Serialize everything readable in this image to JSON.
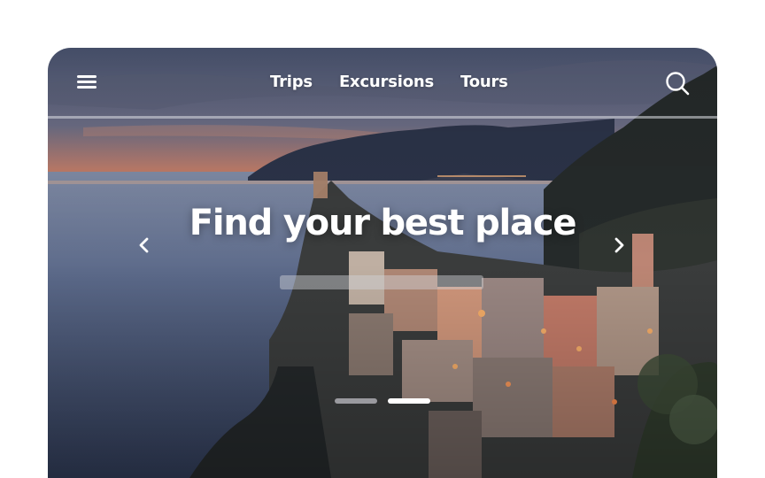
{
  "nav": {
    "menu_icon": "hamburger-menu-icon",
    "links": [
      "Trips",
      "Excursions",
      "Tours"
    ],
    "search_icon": "search-icon"
  },
  "hero": {
    "headline": "Find your best place",
    "background": "coastal-village-at-dusk",
    "prev_icon": "chevron-left-icon",
    "next_icon": "chevron-right-icon",
    "slide_count": 2,
    "active_slide": 2
  },
  "colors": {
    "text": "#ffffff",
    "page_background": "#ffffff",
    "sky_top": "#4e5672",
    "sunset": "#d8704a",
    "sea": "#3e4e6e",
    "cliff": "#2a2f2c"
  }
}
